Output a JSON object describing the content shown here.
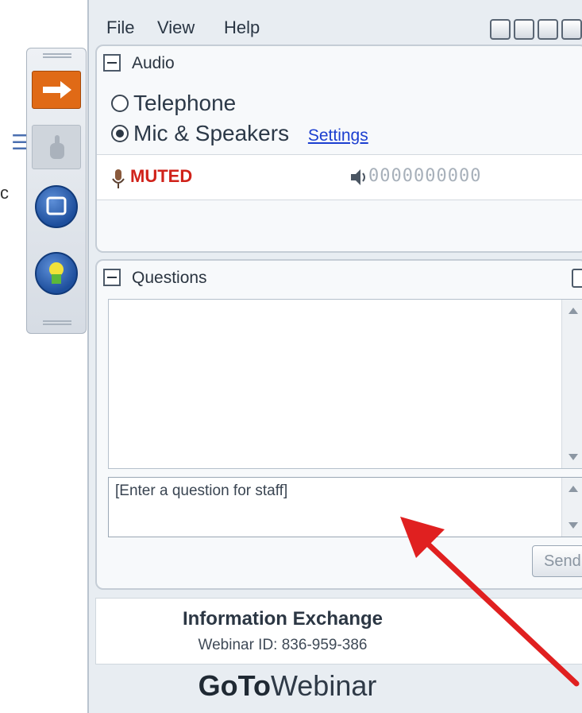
{
  "side_fragment": "c",
  "menu": {
    "file": "File",
    "view": "View",
    "help": "Help"
  },
  "audio": {
    "title": "Audio",
    "option_telephone": "Telephone",
    "option_mic": "Mic & Speakers",
    "selected": "Mic & Speakers",
    "settings_link": "Settings",
    "mute_status": "MUTED",
    "level_meter": "0000000000"
  },
  "questions": {
    "title": "Questions",
    "input_placeholder": "[Enter a question for staff]",
    "send_label": "Send"
  },
  "info": {
    "title": "Information Exchange",
    "webinar_id": "Webinar ID: 836-959-386"
  },
  "brand": {
    "bold_part": "GoTo",
    "light_part": "Webinar"
  },
  "colors": {
    "muted": "#d0221a",
    "link": "#1c3fd0",
    "arrow": "#e02020",
    "accent_orange": "#e06a16"
  },
  "icons": [
    "arrow-right-icon",
    "raise-hand-icon",
    "screen-share-icon",
    "webcam-icon",
    "mic-icon",
    "speaker-icon",
    "popout-icon",
    "minimize-icon",
    "restore-icon",
    "maximize-icon",
    "close-icon"
  ]
}
